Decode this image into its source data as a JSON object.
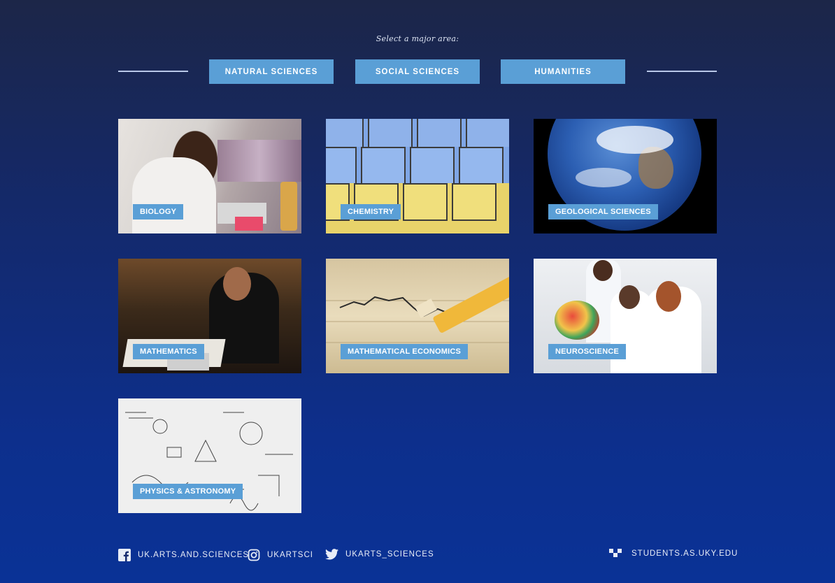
{
  "prompt": "Select a major area:",
  "tabs": [
    {
      "label": "NATURAL SCIENCES"
    },
    {
      "label": "SOCIAL SCIENCES"
    },
    {
      "label": "HUMANITIES"
    }
  ],
  "majors": [
    {
      "label": "BIOLOGY",
      "art": "lab-researcher-photo"
    },
    {
      "label": "CHEMISTRY",
      "art": "periodic-table-photo"
    },
    {
      "label": "GEOLOGICAL SCIENCES",
      "art": "earth-from-space-photo"
    },
    {
      "label": "MATHEMATICS",
      "art": "student-studying-photo"
    },
    {
      "label": "MATHEMATICAL ECONOMICS",
      "art": "stock-chart-pencil-photo"
    },
    {
      "label": "NEUROSCIENCE",
      "art": "brain-model-lab-photo"
    },
    {
      "label": "PHYSICS & ASTRONOMY",
      "art": "equations-sketch-photo"
    }
  ],
  "footer": {
    "facebook": {
      "icon": "facebook-icon",
      "label": "UK.ARTS.AND.SCIENCES"
    },
    "instagram": {
      "icon": "instagram-icon",
      "label": "UKARTSCI"
    },
    "twitter": {
      "icon": "twitter-icon",
      "label": "UKARTS_SCIENCES"
    },
    "website": {
      "icon": "uk-logo-icon",
      "label": "STUDENTS.AS.UKY.EDU"
    }
  },
  "colors": {
    "accent": "#5a9fd6",
    "background_top": "#1c2648",
    "background_bottom": "#0a3296"
  }
}
